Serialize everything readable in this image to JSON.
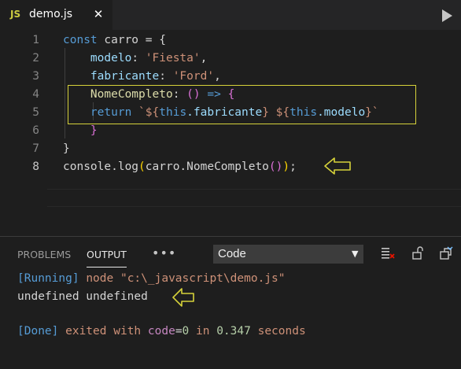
{
  "tab": {
    "lang": "JS",
    "filename": "demo.js",
    "close": "✕"
  },
  "colors": {
    "highlight": "#d6d23a",
    "accent": "#569cd6",
    "string": "#ce9178"
  },
  "icons": [
    "run-icon",
    "clear-output-icon",
    "lock-scroll-icon",
    "maximize-panel-icon",
    "more-actions-icon"
  ],
  "editor": {
    "line_numbers": [
      "1",
      "2",
      "3",
      "4",
      "5",
      "6",
      "7",
      "8"
    ],
    "active_line": "8",
    "lines": [
      [
        {
          "t": "const",
          "c": "kw"
        },
        {
          "t": " carro = {",
          "c": "plain"
        }
      ],
      [
        {
          "t": "    ",
          "c": "plain"
        },
        {
          "t": "modelo",
          "c": "var"
        },
        {
          "t": ": ",
          "c": "plain"
        },
        {
          "t": "'Fiesta'",
          "c": "str"
        },
        {
          "t": ",",
          "c": "plain"
        }
      ],
      [
        {
          "t": "    ",
          "c": "plain"
        },
        {
          "t": "fabricante",
          "c": "var"
        },
        {
          "t": ": ",
          "c": "plain"
        },
        {
          "t": "'Ford'",
          "c": "str"
        },
        {
          "t": ",",
          "c": "plain"
        }
      ],
      [
        {
          "t": "    ",
          "c": "plain"
        },
        {
          "t": "NomeCompleto",
          "c": "fn"
        },
        {
          "t": ": ",
          "c": "plain"
        },
        {
          "t": "()",
          "c": "br"
        },
        {
          "t": " ",
          "c": "plain"
        },
        {
          "t": "=>",
          "c": "kw"
        },
        {
          "t": " ",
          "c": "plain"
        },
        {
          "t": "{",
          "c": "br"
        }
      ],
      [
        {
          "t": "    ",
          "c": "plain"
        },
        {
          "t": "return",
          "c": "kw"
        },
        {
          "t": " ",
          "c": "plain"
        },
        {
          "t": "`${",
          "c": "str"
        },
        {
          "t": "this",
          "c": "kw"
        },
        {
          "t": ".fabricante",
          "c": "var"
        },
        {
          "t": "}",
          "c": "str"
        },
        {
          "t": " ",
          "c": "str"
        },
        {
          "t": "${",
          "c": "str"
        },
        {
          "t": "this",
          "c": "kw"
        },
        {
          "t": ".modelo",
          "c": "var"
        },
        {
          "t": "}`",
          "c": "str"
        }
      ],
      [
        {
          "t": "    ",
          "c": "plain"
        },
        {
          "t": "}",
          "c": "br"
        }
      ],
      [
        {
          "t": "}",
          "c": "plain"
        }
      ],
      [
        {
          "t": "console",
          "c": "plain"
        },
        {
          "t": ".",
          "c": "plain"
        },
        {
          "t": "log",
          "c": "plain"
        },
        {
          "t": "(",
          "c": "br2"
        },
        {
          "t": "carro.NomeCompleto",
          "c": "plain"
        },
        {
          "t": "()",
          "c": "br"
        },
        {
          "t": ")",
          "c": "br2"
        },
        {
          "t": ";",
          "c": "plain"
        }
      ]
    ]
  },
  "panel": {
    "tabs": [
      "PROBLEMS",
      "OUTPUT"
    ],
    "active_tab": "OUTPUT",
    "more": "•••",
    "channel": "Code",
    "output": [
      [
        {
          "t": "[Running]",
          "c": "o-blue"
        },
        {
          "t": " ",
          "c": "o-white"
        },
        {
          "t": "node",
          "c": "o-orange"
        },
        {
          "t": " ",
          "c": "o-white"
        },
        {
          "t": "\"c:\\_javascript\\demo.js\"",
          "c": "o-str"
        }
      ],
      [
        {
          "t": "undefined undefined",
          "c": "o-white"
        }
      ],
      [
        {
          "t": "",
          "c": "o-white"
        }
      ],
      [
        {
          "t": "[Done]",
          "c": "o-blue"
        },
        {
          "t": " exited with ",
          "c": "o-orange"
        },
        {
          "t": "code",
          "c": "o-key"
        },
        {
          "t": "=",
          "c": "o-white"
        },
        {
          "t": "0",
          "c": "o-num"
        },
        {
          "t": " in ",
          "c": "o-orange"
        },
        {
          "t": "0.347",
          "c": "o-num"
        },
        {
          "t": " seconds",
          "c": "o-orange"
        }
      ]
    ]
  }
}
